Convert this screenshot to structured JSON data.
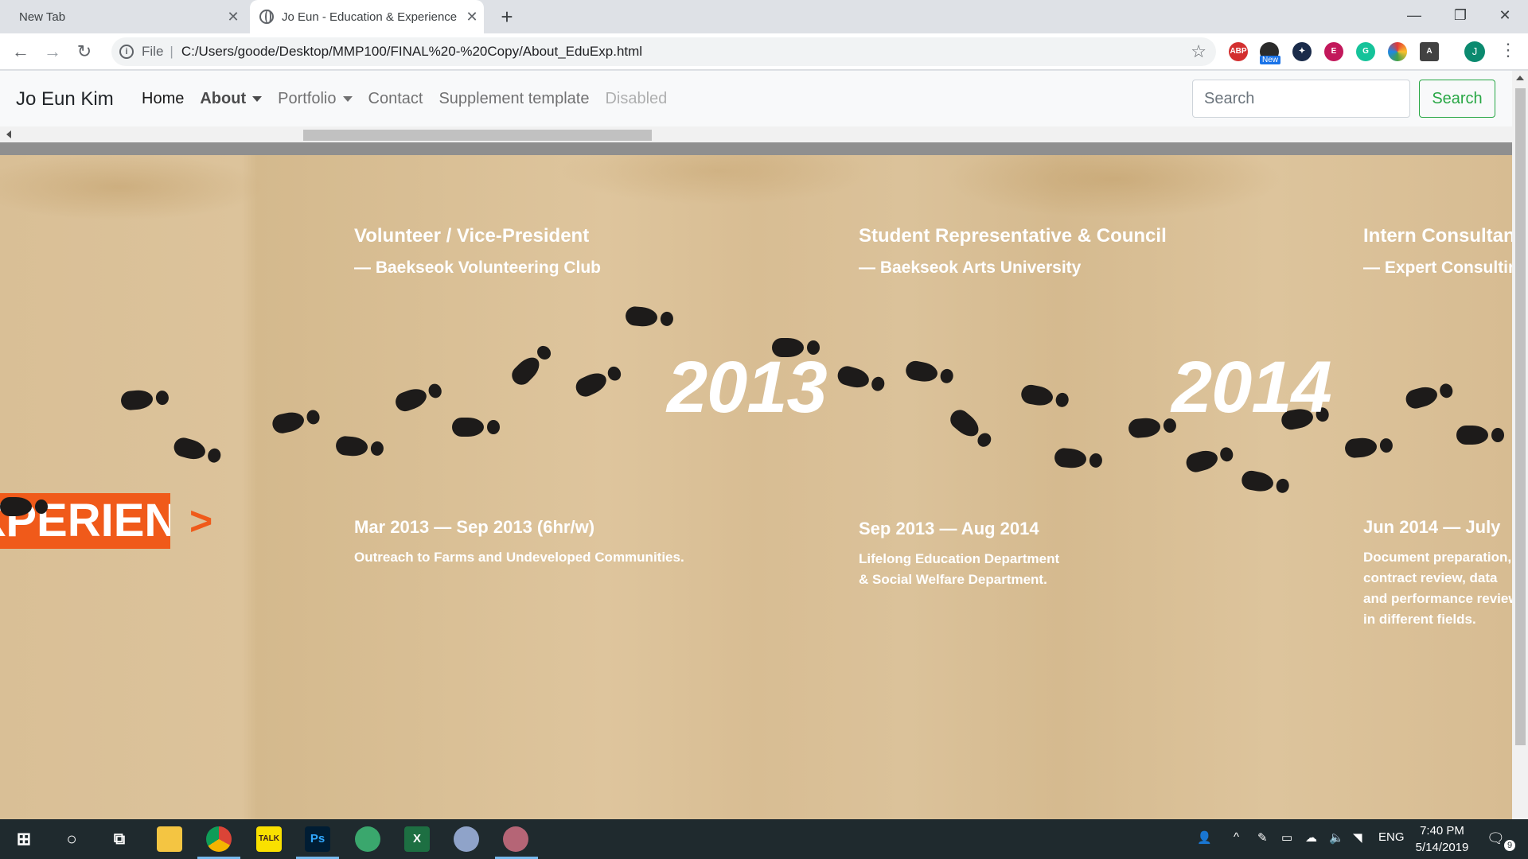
{
  "browser": {
    "tabs": [
      {
        "title": "New Tab",
        "active": false
      },
      {
        "title": "Jo Eun - Education & Experience",
        "active": true
      }
    ],
    "address": {
      "scheme": "File",
      "url": "C:/Users/goode/Desktop/MMP100/FINAL%20-%20Copy/About_EduExp.html"
    },
    "extensions": [
      "ABP",
      "New",
      "E",
      "G"
    ],
    "profile_initial": "J"
  },
  "navbar": {
    "brand": "Jo Eun Kim",
    "links": {
      "home": "Home",
      "about": "About",
      "portfolio": "Portfolio",
      "contact": "Contact",
      "supplement": "Supplement template",
      "disabled": "Disabled"
    },
    "search_placeholder": "Search",
    "search_button": "Search"
  },
  "timeline": {
    "banner": "EXPERIENCE",
    "banner_arrow": ">",
    "entries": [
      {
        "year": "2013",
        "title": "Volunteer / Vice-President",
        "org": "— Baekseok Volunteering Club",
        "date": "Mar 2013 — Sep 2013 (6hr/w)",
        "desc": [
          "Outreach to Farms and Undeveloped Communities."
        ]
      },
      {
        "year": "2014",
        "title": "Student Representative & Council",
        "org": "— Baekseok Arts University",
        "date": "Sep 2013 — Aug 2014",
        "desc": [
          "Lifelong Education Department",
          "& Social Welfare Department."
        ]
      },
      {
        "title": "Intern Consultant",
        "org": "— Expert Consulting",
        "date": "Jun 2014 — July",
        "desc": [
          "Document preparation,",
          "contract review, data",
          "and performance review",
          "in different fields."
        ]
      }
    ]
  },
  "taskbar": {
    "language": "ENG",
    "time": "7:40 PM",
    "date": "5/14/2019",
    "notification_count": "9",
    "apps": [
      "TALK",
      "Ps",
      "X"
    ]
  },
  "colors": {
    "accent_orange": "#f05a1a",
    "search_green": "#28a745",
    "paper": "#d9bf96",
    "footprint": "#1d1b1a"
  }
}
